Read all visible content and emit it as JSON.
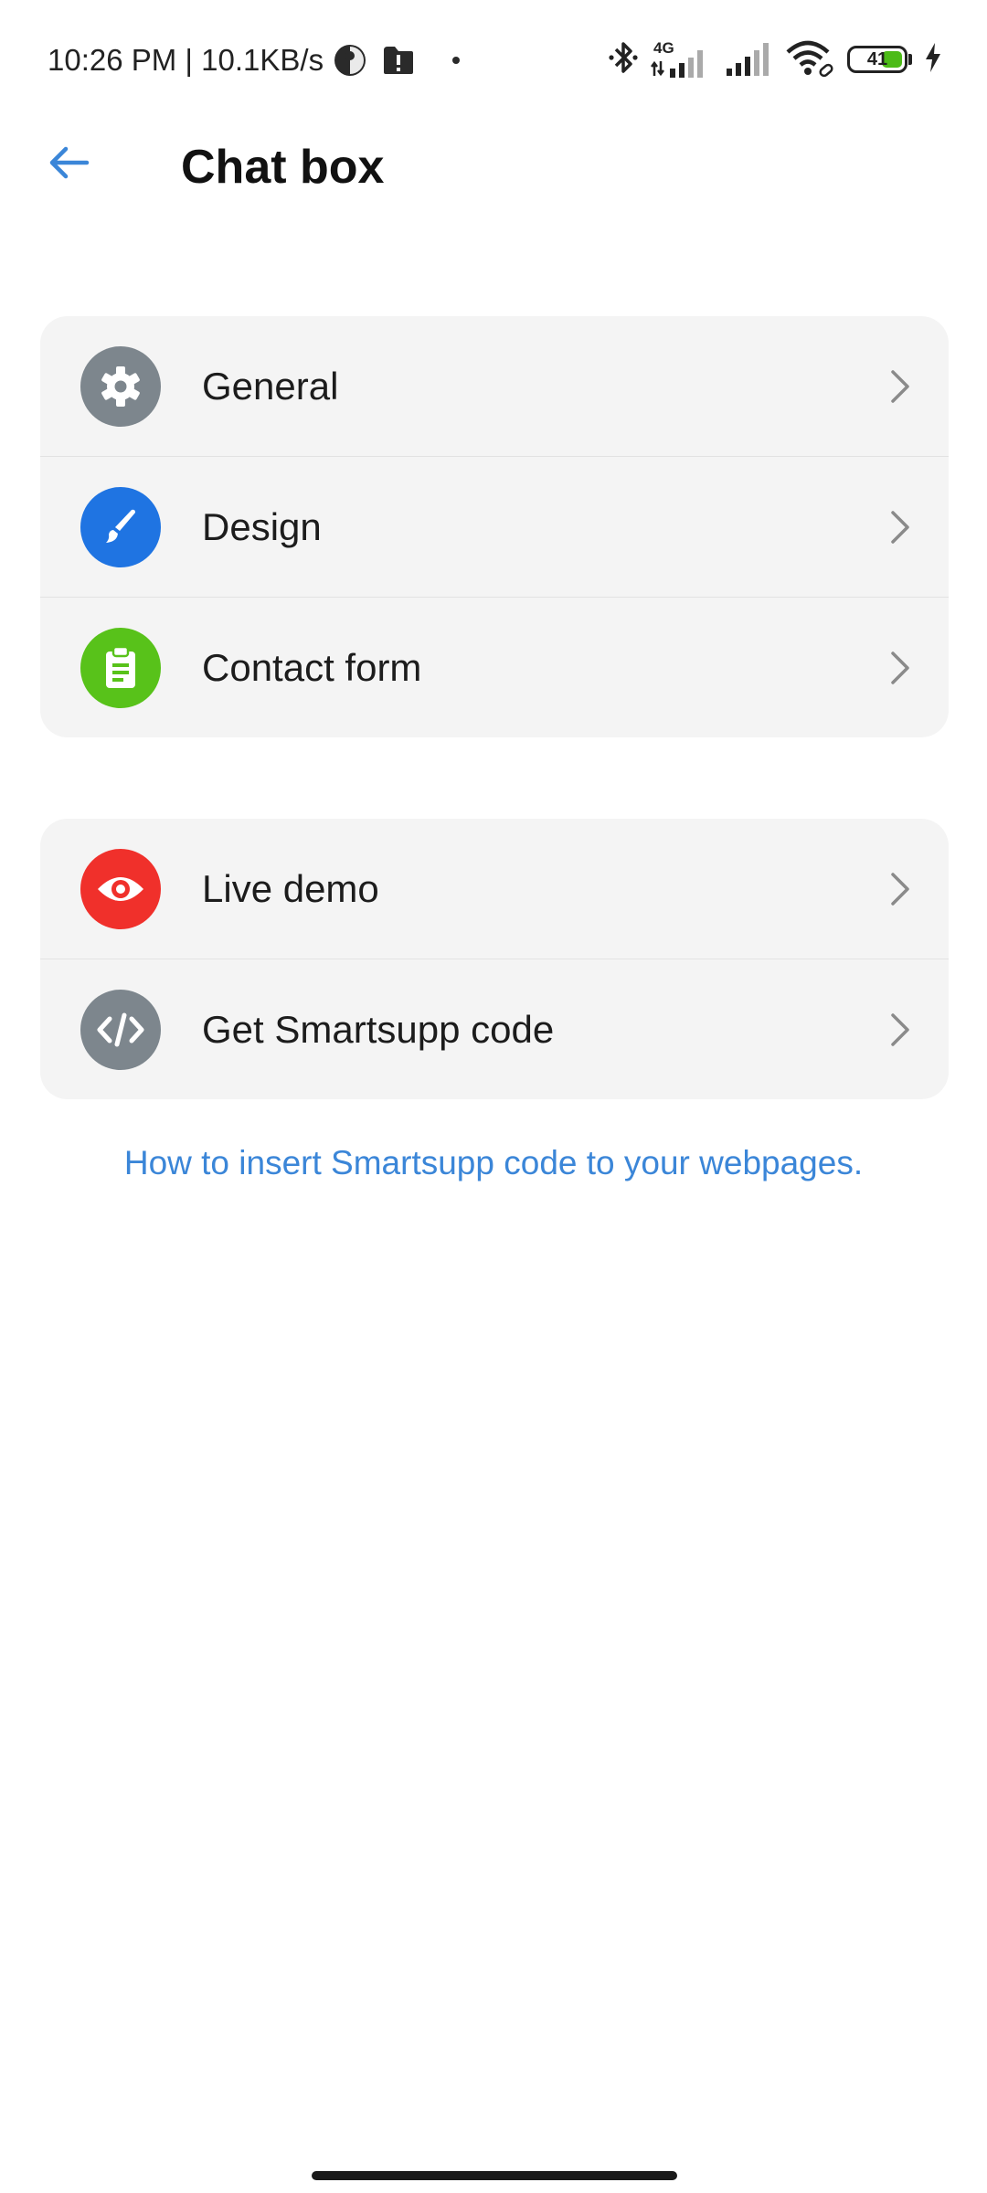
{
  "status_bar": {
    "time_speed": "10:26 PM | 10.1KB/s",
    "network_label": "4G",
    "battery_level": "41",
    "battery_fraction": 0.41,
    "icons": [
      "privacy-icon",
      "sd-card-icon",
      "dot-icon",
      "bluetooth-icon",
      "signal-4g-icon",
      "signal-icon",
      "wifi-icon",
      "battery-icon",
      "charging-icon"
    ]
  },
  "header": {
    "title": "Chat box",
    "back_icon": "arrow-left-icon"
  },
  "settings_groups": [
    {
      "items": [
        {
          "label": "General",
          "icon": "gear-icon",
          "color": "#7d868d"
        },
        {
          "label": "Design",
          "icon": "brush-icon",
          "color": "#1f74e2"
        },
        {
          "label": "Contact form",
          "icon": "clipboard-icon",
          "color": "#58c21a"
        }
      ]
    },
    {
      "items": [
        {
          "label": "Live demo",
          "icon": "eye-icon",
          "color": "#f0302b"
        },
        {
          "label": "Get Smartsupp code",
          "icon": "code-icon",
          "color": "#7d868d"
        }
      ]
    }
  ],
  "help_link": {
    "text": "How to insert Smartsupp code to your webpages."
  },
  "colors": {
    "accent": "#3b86d8",
    "card_background": "#f4f4f4",
    "battery_fill": "#4cbb17"
  }
}
